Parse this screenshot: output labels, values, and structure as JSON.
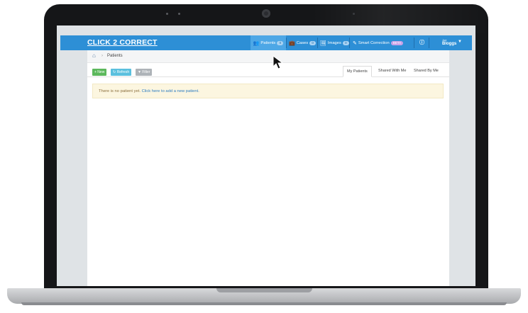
{
  "app": {
    "brand": "CLICK 2 CORRECT"
  },
  "nav": {
    "patients": {
      "label": "Patients",
      "count": "0"
    },
    "cases": {
      "label": "Cases",
      "count": "0"
    },
    "images": {
      "label": "Images",
      "count": "0"
    },
    "smart": {
      "label": "Smart Correction",
      "badge": "BETA"
    },
    "user": {
      "first": "Joe",
      "last": "Bloggs"
    }
  },
  "breadcrumb": {
    "current": "Patients"
  },
  "toolbar": {
    "new": "+ New",
    "refresh": "Refresh",
    "filter": "Filter"
  },
  "tabs": {
    "mine": "My Patients",
    "shared_with": "Shared With Me",
    "shared_by": "Shared By Me"
  },
  "alert": {
    "text": "There is no patient yet. ",
    "link": "Click here to add a new patient."
  },
  "colors": {
    "accent": "#2d8fd6",
    "alert_bg": "#fcf6e0"
  }
}
